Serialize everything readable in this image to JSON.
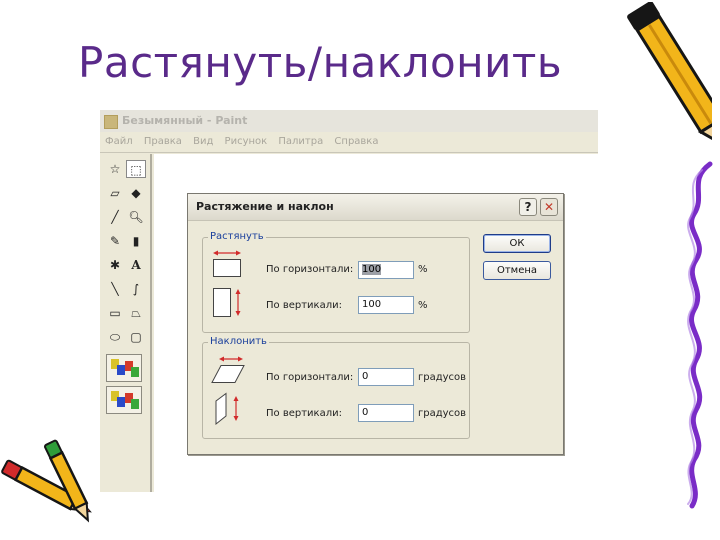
{
  "slide": {
    "title": "Растянуть/наклонить"
  },
  "paint": {
    "window_title": "Безымянный - Paint",
    "menu": [
      "Файл",
      "Правка",
      "Вид",
      "Рисунок",
      "Палитра",
      "Справка"
    ]
  },
  "dialog": {
    "title": "Растяжение и наклон",
    "help_label": "?",
    "close_label": "✕",
    "stretch_group": {
      "label": "Растянуть",
      "horizontal": {
        "label": "По горизонтали:",
        "value": "100",
        "unit": "%"
      },
      "vertical": {
        "label": "По вертикали:",
        "value": "100",
        "unit": "%"
      }
    },
    "skew_group": {
      "label": "Наклонить",
      "horizontal": {
        "label": "По горизонтали:",
        "value": "0",
        "unit": "градусов"
      },
      "vertical": {
        "label": "По вертикали:",
        "value": "0",
        "unit": "градусов"
      }
    },
    "ok_label": "ОК",
    "cancel_label": "Отмена"
  },
  "colors": {
    "title": "#5a2a8a",
    "group_label": "#1a3f9c",
    "stretch_arrows": "#d12b2b",
    "squiggle": "#7a2cc7",
    "pencil_body": "#f2b51a"
  }
}
